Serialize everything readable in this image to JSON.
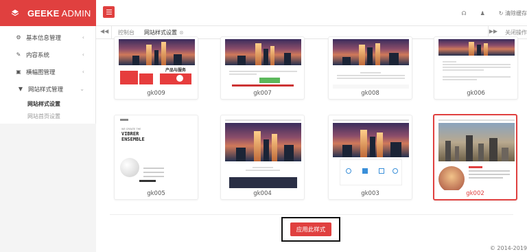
{
  "brand": {
    "name_bold": "GEEKE",
    "name_light": " ADMIN"
  },
  "sidebar": {
    "items": [
      {
        "label": "基本信息管理",
        "icon": "gear-icon",
        "glyph": "⚙",
        "arrow": "‹"
      },
      {
        "label": "内容系统",
        "icon": "edit-icon",
        "glyph": "✎",
        "arrow": "‹"
      },
      {
        "label": "横幅图管理",
        "icon": "image-icon",
        "glyph": "▣",
        "arrow": "‹"
      },
      {
        "label": "网站样式管理",
        "icon": "shield-icon",
        "glyph": "▼",
        "arrow": "⌄"
      }
    ],
    "sub_items": [
      {
        "label": "网站样式设置",
        "active": true
      },
      {
        "label": "网站首页设置",
        "active": false
      }
    ]
  },
  "header": {
    "tools": {
      "headset": "☊",
      "user": "♟",
      "refresh": "↻",
      "clear_cache": "清除缓存"
    }
  },
  "tabs": {
    "prev": "◀◀",
    "home": "控制台",
    "current": "网站样式设置",
    "current_close": "⊗",
    "next": "▶▶",
    "close_ops": "关闭操作"
  },
  "templates": [
    {
      "name": "gk009"
    },
    {
      "name": "gk007"
    },
    {
      "name": "gk008"
    },
    {
      "name": "gk006"
    },
    {
      "name": "gk005"
    },
    {
      "name": "gk004"
    },
    {
      "name": "gk003"
    },
    {
      "name": "gk002",
      "selected": true
    }
  ],
  "thumb_text": {
    "gk009_heading": "产品与服务",
    "gk005_line1": "WE CREATE THE",
    "gk005_line2": "VIBRER",
    "gk005_line3": "ENSEMBLE"
  },
  "apply_button": "应用此样式",
  "copyright": "© 2014-2019",
  "colors": {
    "accent": "#e0403f",
    "sidebar_bg": "#f4f4f4"
  }
}
